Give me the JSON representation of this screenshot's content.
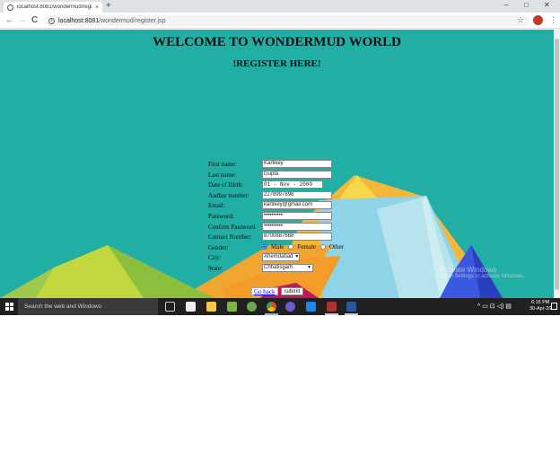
{
  "browser": {
    "tab_title": "localhost:8081/wondermud/regi",
    "tab_close": "×",
    "new_tab": "+",
    "url_host": "localhost:8081",
    "url_path": "/wondermud/register.jsp",
    "back": "←",
    "forward": "→",
    "reload": "C",
    "star": "☆",
    "menu": "⋮",
    "window_controls": {
      "minimize": "–",
      "maximize": "□",
      "close": "✕"
    }
  },
  "page": {
    "title": "WELCOME TO WONDERMUD WORLD",
    "subtitle": "!REGISTER HERE!",
    "form": {
      "first_name": {
        "label": "First name:",
        "value": "Kartikey"
      },
      "last_name": {
        "label": "Last name:",
        "value": "Gupta"
      },
      "dob": {
        "label": "Date of Birth:",
        "value": "01 - Nov - 2000"
      },
      "aadhar": {
        "label": "Aadhar number:",
        "value": "2278997898"
      },
      "email": {
        "label": "Email:",
        "value": "kartikey@gmail.com"
      },
      "password": {
        "label": "Password:",
        "value": "••••••••••"
      },
      "confirm_password": {
        "label": "Confirm Password",
        "value": "••••••••••"
      },
      "contact": {
        "label": "Contact Number:",
        "value": "8700887668"
      },
      "gender": {
        "label": "Gender:",
        "options": [
          "Male",
          "Female",
          "Other"
        ],
        "selected": "Male"
      },
      "city": {
        "label": "City:",
        "value": "Ahemdabad"
      },
      "state": {
        "label": "State:",
        "value": "Chhatisgarh"
      }
    },
    "go_back": "Go back",
    "submit": "submit",
    "watermark_line1": "Activate Windows",
    "watermark_line2": "Go to Settings to activate Windows."
  },
  "taskbar": {
    "search_placeholder": "Search the web and Windows",
    "tray_icons": "^ ▭ ⊡ ◁) ▤",
    "time": "6:15 PM",
    "date": "30-Apr-20"
  },
  "colors": {
    "page_bg": "#20aea5",
    "taskbar_bg": "#202020",
    "accent": "#1a73e8"
  }
}
